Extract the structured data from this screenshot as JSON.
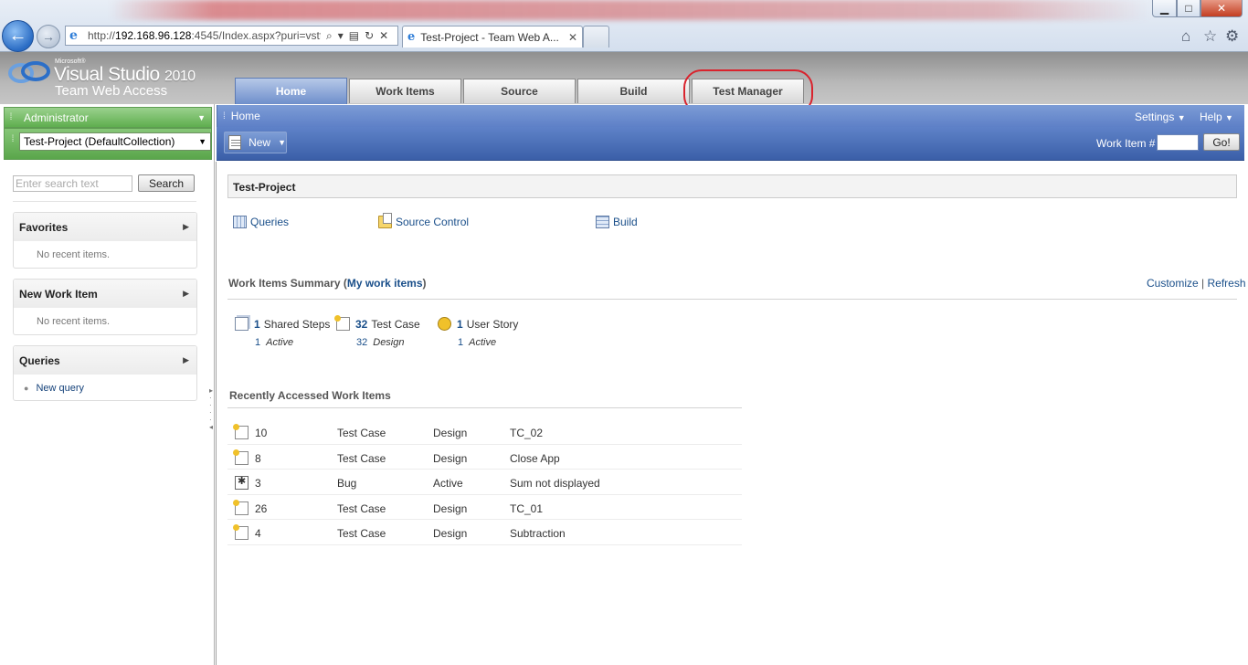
{
  "browser": {
    "address_host": "192.168.96.128",
    "address_rest": ":4545/Index.aspx?puri=vstfs",
    "address_prefix": "http://",
    "tab_title": "Test-Project - Team Web A...",
    "window_buttons": {
      "minimize": "▁",
      "maximize": "□",
      "close": "✕"
    }
  },
  "logo": {
    "microsoft": "Microsoft®",
    "product": "Visual Studio",
    "year": "2010",
    "subtitle": "Team Web Access"
  },
  "main_tabs": [
    {
      "label": "Home",
      "active": true
    },
    {
      "label": "Work Items",
      "active": false
    },
    {
      "label": "Source",
      "active": false
    },
    {
      "label": "Build",
      "active": false
    },
    {
      "label": "Test Manager",
      "active": false
    }
  ],
  "left": {
    "user": "Administrator",
    "project": "Test-Project (DefaultCollection)",
    "search_placeholder": "Enter search text",
    "search_button": "Search",
    "favorites": {
      "title": "Favorites",
      "empty": "No recent items."
    },
    "new_work_item": {
      "title": "New Work Item",
      "empty": "No recent items."
    },
    "queries": {
      "title": "Queries",
      "link": "New query"
    }
  },
  "crumb": {
    "home": "Home",
    "settings": "Settings",
    "help": "Help"
  },
  "toolbar": {
    "new_label": "New",
    "work_item_label": "Work Item #",
    "go_label": "Go!"
  },
  "content": {
    "project_title": "Test-Project",
    "quick_links": {
      "queries": "Queries",
      "source_control": "Source Control",
      "build": "Build"
    },
    "summary": {
      "title_prefix": "Work Items Summary (",
      "title_link": "My work items",
      "title_suffix": ")",
      "customize": "Customize",
      "separator": "|",
      "refresh": "Refresh",
      "items": [
        {
          "count": "1",
          "type": "Shared Steps",
          "sub_count": "1",
          "sub_state": "Active"
        },
        {
          "count": "32",
          "type": "Test Case",
          "sub_count": "32",
          "sub_state": "Design"
        },
        {
          "count": "1",
          "type": "User Story",
          "sub_count": "1",
          "sub_state": "Active"
        }
      ]
    },
    "recent": {
      "title": "Recently Accessed Work Items",
      "rows": [
        {
          "id": "10",
          "type": "Test Case",
          "state": "Design",
          "title": "TC_02"
        },
        {
          "id": "8",
          "type": "Test Case",
          "state": "Design",
          "title": "Close App"
        },
        {
          "id": "3",
          "type": "Bug",
          "state": "Active",
          "title": "Sum not displayed"
        },
        {
          "id": "26",
          "type": "Test Case",
          "state": "Design",
          "title": "TC_01"
        },
        {
          "id": "4",
          "type": "Test Case",
          "state": "Design",
          "title": "Subtraction"
        }
      ]
    }
  },
  "colors": {
    "highlight_oval": "#d9232d",
    "home_tab": "#6e8fcb",
    "green_bar": "#5fae4f",
    "toolbar_blue": "#3b5fa8",
    "link": "#1a4f8a"
  }
}
